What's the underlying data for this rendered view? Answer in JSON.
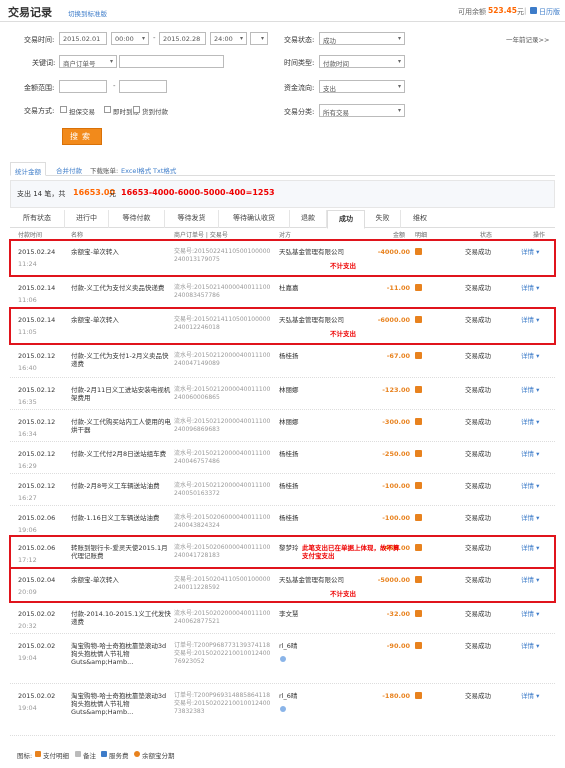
{
  "header": {
    "title": "交易记录",
    "switch_link": "切换到标准版",
    "balance_label": "可用余额",
    "balance_value": "523.45",
    "balance_unit": "元",
    "calendar_link": "日历版"
  },
  "filters": {
    "time_label": "交易时间:",
    "start_date": "2015.02.01",
    "start_hour": "00:00",
    "end_date": "2015.02.28",
    "end_hour": "24:00",
    "status_label": "交易状态:",
    "status_value": "成功",
    "keyword_label": "关键词:",
    "keyword_type": "商户订单号",
    "time_type_label": "时间类型:",
    "time_type_value": "付款时间",
    "amount_label": "金额范围:",
    "fund_flow_label": "资金流向:",
    "fund_flow_value": "支出",
    "method_label": "交易方式:",
    "method_options": [
      "担保交易",
      "即时到账",
      "货到付款"
    ],
    "category_label": "交易分类:",
    "category_value": "所有交易",
    "search_button": "搜索",
    "year_ago_link": "一年前记录>>"
  },
  "export": {
    "stats_tab": "统计金额",
    "merge_label": "合并付款",
    "download_label": "下载账单:",
    "excel_link": "Excel格式",
    "txt_link": "Txt格式"
  },
  "summary": {
    "prefix": "支出 14 笔，共",
    "total": "16653.00",
    "unit": "元",
    "note": "16653-4000-6000-5000-400=1253"
  },
  "tabs": [
    "所有状态",
    "进行中",
    "等待付款",
    "等待发货",
    "等待确认收货",
    "退款",
    "成功",
    "失败",
    "维权"
  ],
  "table_headers": {
    "time": "付款时间",
    "name": "名称",
    "order": "商户订单号 | 交易号",
    "party": "对方",
    "amount": "金额",
    "detail": "明细",
    "status": "状态",
    "action": "操作"
  },
  "rows": [
    {
      "date": "2015.02.24",
      "time": "11:24",
      "name": "余额宝-单次转入",
      "sn": "交易号:20150224110500100000240013179075",
      "party": "天弘基金管理有限公司",
      "amount": "-4000.00",
      "status": "交易成功",
      "detail": "详情 ▾",
      "note": "不计支出"
    },
    {
      "date": "2015.02.14",
      "time": "11:06",
      "name": "付款-义工代为支付义卖品快递费",
      "sn": "流水号:20150214000040011100240083457786",
      "party": "杜嘉嘉",
      "amount": "-11.00",
      "status": "交易成功",
      "detail": "详情 ▾"
    },
    {
      "date": "2015.02.14",
      "time": "11:05",
      "name": "余额宝-单次转入",
      "sn": "交易号:20150214110500100000240012246018",
      "party": "天弘基金管理有限公司",
      "amount": "-6000.00",
      "status": "交易成功",
      "detail": "详情 ▾",
      "note": "不计支出"
    },
    {
      "date": "2015.02.12",
      "time": "16:40",
      "name": "付款-义工代为支付1-2月义卖品快递费",
      "sn": "流水号:20150212000040011100240047149089",
      "party": "杨桂扬",
      "amount": "-67.00",
      "status": "交易成功",
      "detail": "详情 ▾"
    },
    {
      "date": "2015.02.12",
      "time": "16:35",
      "name": "付款-2月11日义工进站安装电视机架费用",
      "sn": "流水号:20150212000040011100240060006865",
      "party": "林丽娜",
      "amount": "-123.00",
      "status": "交易成功",
      "detail": "详情 ▾"
    },
    {
      "date": "2015.02.12",
      "time": "16:34",
      "name": "付款-义工代购买站内工人使用的电烘干器",
      "sn": "流水号:20150212000040011100240096869683",
      "party": "林丽娜",
      "amount": "-300.00",
      "status": "交易成功",
      "detail": "详情 ▾"
    },
    {
      "date": "2015.02.12",
      "time": "16:29",
      "name": "付款-义工代付2月8日送站组车费",
      "sn": "流水号:20150212000040011100240046757486",
      "party": "杨桂扬",
      "amount": "-250.00",
      "status": "交易成功",
      "detail": "详情 ▾"
    },
    {
      "date": "2015.02.12",
      "time": "16:27",
      "name": "付款-2月8号义工车辆送站油费",
      "sn": "流水号:20150212000040011100240050163372",
      "party": "杨桂扬",
      "amount": "-100.00",
      "status": "交易成功",
      "detail": "详情 ▾"
    },
    {
      "date": "2015.02.06",
      "time": "19:06",
      "name": "付款-1.16日义工车辆送站油费",
      "sn": "流水号:20150206000040011100240043824324",
      "party": "杨桂扬",
      "amount": "-100.00",
      "status": "交易成功",
      "detail": "详情 ▾"
    },
    {
      "date": "2015.02.06",
      "time": "17:12",
      "name": "转账到银行卡-爱灵天使2015.1月代理记账费",
      "sn": "流水号:20150206000040011100240041728183",
      "party": "黎梦玲",
      "amount": "-400.00",
      "status": "交易成功",
      "detail": "详情 ▾",
      "note": "此笔支出已在单据上体现，故不算支付宝支出"
    },
    {
      "date": "2015.02.04",
      "time": "20:09",
      "name": "余额宝-单次转入",
      "sn": "交易号:20150204110500100000240011228592",
      "party": "天弘基金管理有限公司",
      "amount": "-5000.00",
      "status": "交易成功",
      "detail": "详情 ▾",
      "note": "不计支出"
    },
    {
      "date": "2015.02.02",
      "time": "20:32",
      "name": "付款-2014.10-2015.1义工代发快递费",
      "sn": "流水号:20150202000040011100240062877521",
      "party": "李文慧",
      "amount": "-32.00",
      "status": "交易成功",
      "detail": "详情 ▾"
    },
    {
      "date": "2015.02.02",
      "time": "19:04",
      "name": "淘宝购物-哈士奇抱枕靠垫滚动3d狗头抱枕情人节礼物Guts&amp;Hamb...",
      "sn": "订单号:T200P968773139374118 交易号:2015020221001001240076923052",
      "party": "rl_6晴",
      "amount": "-90.00",
      "status": "交易成功",
      "detail": "详情 ▾",
      "dot": true
    },
    {
      "date": "2015.02.02",
      "time": "19:04",
      "name": "淘宝购物-哈士奇抱枕靠垫滚动3d狗头抱枕情人节礼物Guts&amp;Hamb...",
      "sn": "订单号:T200P969314885864118 交易号:2015020221001001240073832383",
      "party": "rl_6晴",
      "amount": "-180.00",
      "status": "交易成功",
      "detail": "详情 ▾",
      "dot": true
    }
  ],
  "legend": {
    "title": "图标:",
    "items": [
      {
        "label": "支付明细",
        "color": "#e8821e"
      },
      {
        "label": "备注",
        "color": "#bbbbbb"
      },
      {
        "label": "服务费",
        "color": "#3d7cc9"
      },
      {
        "label": "余额宝分期",
        "color": "#e8821e"
      }
    ]
  }
}
